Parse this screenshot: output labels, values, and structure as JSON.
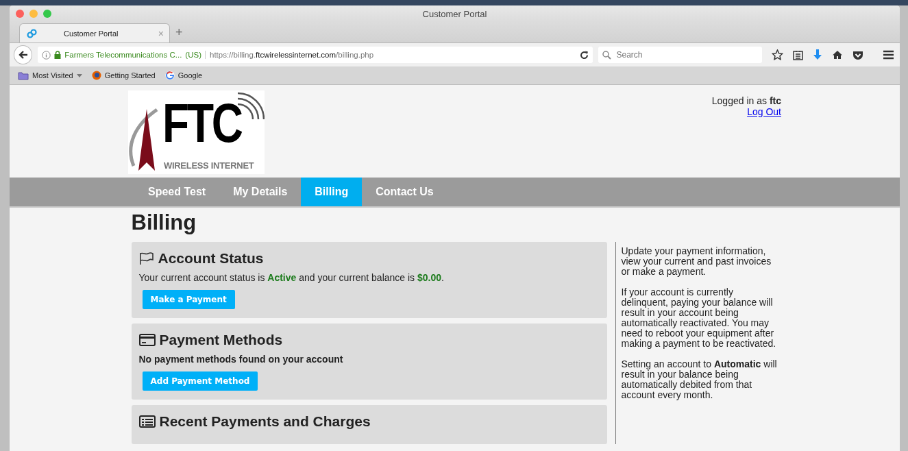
{
  "window": {
    "title": "Customer Portal"
  },
  "tabs": [
    {
      "label": "Customer Portal",
      "selected": true,
      "close": "×"
    }
  ],
  "new_tab": "+",
  "address_bar": {
    "identity": "Farmers Telecommunications C...",
    "country": "(US)",
    "url_prefix": "https://billing.",
    "url_domain": "ftcwirelessinternet.com",
    "url_path": "/billing.php"
  },
  "search": {
    "placeholder": "Search"
  },
  "bookmarks": [
    {
      "label": "Most Visited",
      "kind": "folder"
    },
    {
      "label": "Getting Started",
      "kind": "firefox"
    },
    {
      "label": "Google",
      "kind": "google"
    }
  ],
  "logo": {
    "main": "FTC",
    "sub": "WIRELESS INTERNET"
  },
  "user": {
    "prefix": "Logged in as",
    "name": "ftc",
    "logout": "Log Out"
  },
  "nav": [
    {
      "label": "Speed Test",
      "selected": false
    },
    {
      "label": "My Details",
      "selected": false
    },
    {
      "label": "Billing",
      "selected": true
    },
    {
      "label": "Contact Us",
      "selected": false
    }
  ],
  "page_title": "Billing",
  "cards": [
    {
      "kind": "status",
      "title": "Account Status",
      "text": "Your current account status is **Active** and your current balance is **$0.00**.",
      "button": "Make a Payment"
    },
    {
      "kind": "methods",
      "title": "Payment Methods",
      "text": "No payment methods found on your account",
      "button": "Add Payment Method"
    },
    {
      "kind": "history",
      "title": "Recent Payments and Charges"
    }
  ],
  "sidebar": [
    "Update your payment information, view your current and past invoices or make a payment.",
    "If your account is currently delinquent, paying your balance will result in your account being automatically reactivated. You may need to reboot your equipment after making a payment to be reactivated.",
    "Setting an account to **Automatic** will result in your balance being automatically debited from that account every month."
  ]
}
